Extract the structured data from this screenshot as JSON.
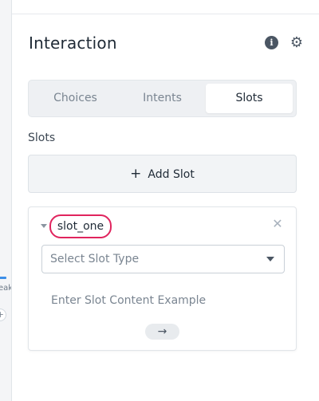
{
  "canvas": {
    "node_text": "eak",
    "add_symbol": "+"
  },
  "panel": {
    "title": "Interaction",
    "icons": {
      "info": "info-icon",
      "settings": "gear-icon"
    },
    "tabs": [
      {
        "label": "Choices",
        "active": false
      },
      {
        "label": "Intents",
        "active": false
      },
      {
        "label": "Slots",
        "active": true
      }
    ],
    "section_label": "Slots",
    "add_slot": {
      "icon": "+",
      "label": "Add Slot"
    },
    "slot": {
      "name": "slot_one",
      "remove_symbol": "✕",
      "type_placeholder": "Select Slot Type",
      "example_placeholder": "Enter Slot Content Example",
      "submit_symbol": "→"
    }
  },
  "colors": {
    "highlight": "#e0245e",
    "active_edge": "#3d8fe8",
    "text_primary": "#1f2a36",
    "text_muted": "#7a8591"
  }
}
